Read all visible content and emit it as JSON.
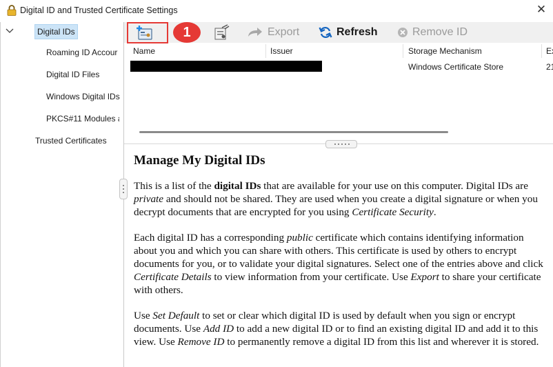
{
  "window": {
    "title": "Digital ID and Trusted Certificate Settings",
    "close_glyph": "✕"
  },
  "sidebar": {
    "items": [
      {
        "label": "Digital IDs"
      },
      {
        "label": "Roaming ID Accour"
      },
      {
        "label": "Digital ID Files"
      },
      {
        "label": "Windows Digital IDs"
      },
      {
        "label": "PKCS#11 Modules a"
      },
      {
        "label": "Trusted Certificates"
      }
    ]
  },
  "toolbar": {
    "badge": "1",
    "export_label": "Export",
    "refresh_label": "Refresh",
    "remove_label": "Remove ID"
  },
  "table": {
    "columns": [
      "Name",
      "Issuer",
      "Storage Mechanism",
      "Ex"
    ],
    "rows": [
      {
        "storage": "Windows Certificate Store",
        "expires": "21"
      }
    ]
  },
  "content": {
    "heading": "Manage My Digital IDs",
    "p1": [
      "This is a list of the ",
      "digital IDs",
      " that are available for your use on this computer. Digital IDs are ",
      "private",
      " and should not be shared. They are used when you create a digital signature or when you decrypt documents that are encrypted for you using ",
      "Certificate Security",
      "."
    ],
    "p2": [
      "Each digital ID has a corresponding ",
      "public",
      " certificate which contains identifying information about you and which you can share with others. This certificate is used by others to encrypt documents for you, or to validate your digital signatures. Select one of the entries above and click ",
      "Certificate Details",
      " to view information from your certificate. Use ",
      "Export",
      " to share your certificate with others."
    ],
    "p3": [
      "Use ",
      "Set Default",
      " to set or clear which digital ID is used by default when you sign or encrypt documents. Use ",
      "Add ID",
      " to add a new digital ID or to find an existing digital ID and add it to this view. Use ",
      "Remove ID",
      " to permanently remove a digital ID from this list and wherever it is stored."
    ]
  },
  "colors": {
    "highlight_red": "#e53935",
    "selected_bg": "#cce4f7",
    "toolbar_bg": "#f0f0f0",
    "disabled_text": "#9a9a9a",
    "refresh_blue": "#1565c0"
  },
  "icons": [
    "lock-icon",
    "close-icon",
    "chevron-down-icon",
    "add-id-icon",
    "certificate-details-icon",
    "export-arrow-icon",
    "refresh-icon",
    "remove-icon"
  ]
}
